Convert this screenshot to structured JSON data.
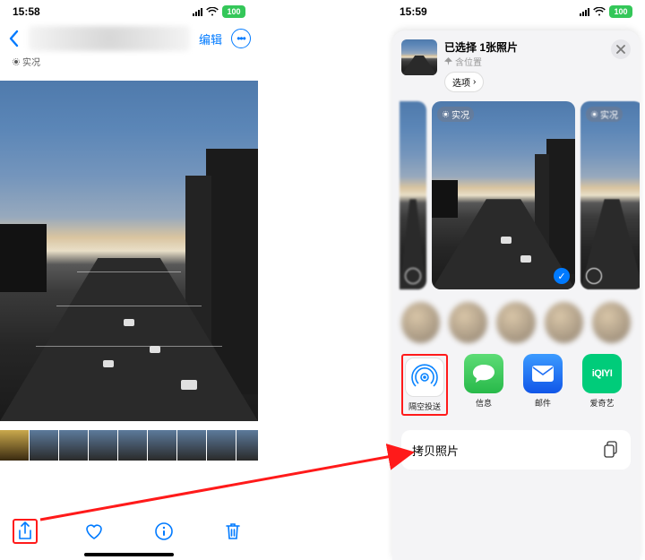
{
  "status": {
    "left_time": "15:58",
    "right_time": "15:59",
    "battery": "100"
  },
  "left": {
    "edit": "编辑",
    "live_label": "实况",
    "toolbar": {
      "share": "share",
      "like": "like",
      "info": "info",
      "delete": "delete"
    }
  },
  "right": {
    "header": {
      "title": "已选择 1张照片",
      "subtitle": "含位置",
      "options": "选项",
      "chevron": "›"
    },
    "live_label": "实况",
    "apps": [
      {
        "name": "隔空投送",
        "color": "#ffffff",
        "icon": "airdrop",
        "fg": "#0a84ff",
        "border": "1px solid #d0d0d0"
      },
      {
        "name": "信息",
        "color": "#34c759",
        "icon": "messages"
      },
      {
        "name": "邮件",
        "color": "#1e6ff5",
        "icon": "mail"
      },
      {
        "name": "爱奇艺",
        "color": "#00cc7a",
        "icon": "iqiyi"
      }
    ],
    "actions": {
      "copy": "拷贝照片"
    }
  }
}
